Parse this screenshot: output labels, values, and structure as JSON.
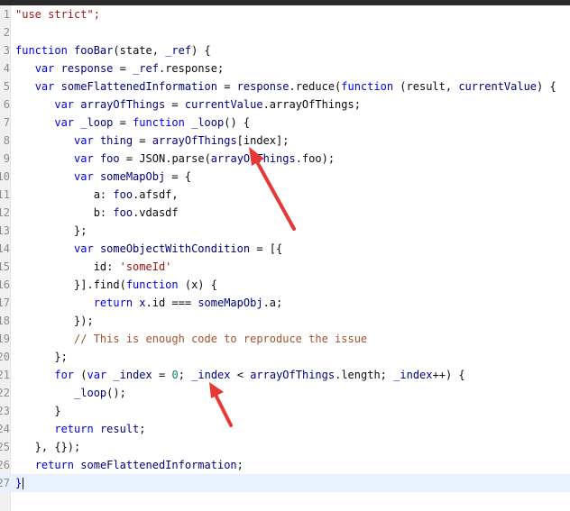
{
  "editor": {
    "lines": [
      {
        "n": "1",
        "tokens": [
          {
            "t": "\"use strict\";",
            "c": "str"
          }
        ]
      },
      {
        "n": "2",
        "tokens": []
      },
      {
        "n": "3",
        "tokens": [
          {
            "t": "function ",
            "c": "kw"
          },
          {
            "t": "fooBar",
            "c": "id"
          },
          {
            "t": "(state, ",
            "c": "prop"
          },
          {
            "t": "_ref",
            "c": "id"
          },
          {
            "t": ") {",
            "c": "prop"
          }
        ]
      },
      {
        "n": "4",
        "tokens": [
          {
            "t": "   ",
            "c": ""
          },
          {
            "t": "var ",
            "c": "kw"
          },
          {
            "t": "response",
            "c": "id"
          },
          {
            "t": " = ",
            "c": "prop"
          },
          {
            "t": "_ref",
            "c": "id"
          },
          {
            "t": ".response;",
            "c": "prop"
          }
        ]
      },
      {
        "n": "5",
        "tokens": [
          {
            "t": "   ",
            "c": ""
          },
          {
            "t": "var ",
            "c": "kw"
          },
          {
            "t": "someFlattenedInformation",
            "c": "id"
          },
          {
            "t": " = ",
            "c": "prop"
          },
          {
            "t": "response",
            "c": "id"
          },
          {
            "t": ".reduce(",
            "c": "prop"
          },
          {
            "t": "function ",
            "c": "kw"
          },
          {
            "t": "(result, ",
            "c": "prop"
          },
          {
            "t": "currentValue",
            "c": "id"
          },
          {
            "t": ") {",
            "c": "prop"
          }
        ]
      },
      {
        "n": "6",
        "tokens": [
          {
            "t": "      ",
            "c": ""
          },
          {
            "t": "var ",
            "c": "kw"
          },
          {
            "t": "arrayOfThings",
            "c": "id"
          },
          {
            "t": " = ",
            "c": "prop"
          },
          {
            "t": "currentValue",
            "c": "id"
          },
          {
            "t": ".arrayOfThings;",
            "c": "prop"
          }
        ]
      },
      {
        "n": "7",
        "tokens": [
          {
            "t": "      ",
            "c": ""
          },
          {
            "t": "var ",
            "c": "kw"
          },
          {
            "t": "_loop",
            "c": "id"
          },
          {
            "t": " = ",
            "c": "prop"
          },
          {
            "t": "function ",
            "c": "kw"
          },
          {
            "t": "_loop",
            "c": "id"
          },
          {
            "t": "() {",
            "c": "prop"
          }
        ]
      },
      {
        "n": "8",
        "tokens": [
          {
            "t": "         ",
            "c": ""
          },
          {
            "t": "var ",
            "c": "kw"
          },
          {
            "t": "thing",
            "c": "id"
          },
          {
            "t": " = ",
            "c": "prop"
          },
          {
            "t": "arrayOfThings",
            "c": "id"
          },
          {
            "t": "[index];",
            "c": "prop"
          }
        ]
      },
      {
        "n": "9",
        "tokens": [
          {
            "t": "         ",
            "c": ""
          },
          {
            "t": "var ",
            "c": "kw"
          },
          {
            "t": "foo",
            "c": "id"
          },
          {
            "t": " = ",
            "c": "prop"
          },
          {
            "t": "JSON",
            "c": "prop"
          },
          {
            "t": ".parse(",
            "c": "prop"
          },
          {
            "t": "arrayOfThings",
            "c": "id"
          },
          {
            "t": ".foo);",
            "c": "prop"
          }
        ]
      },
      {
        "n": "10",
        "tokens": [
          {
            "t": "         ",
            "c": ""
          },
          {
            "t": "var ",
            "c": "kw"
          },
          {
            "t": "someMapObj",
            "c": "id"
          },
          {
            "t": " = {",
            "c": "prop"
          }
        ]
      },
      {
        "n": "11",
        "tokens": [
          {
            "t": "            a: ",
            "c": "prop"
          },
          {
            "t": "foo",
            "c": "id"
          },
          {
            "t": ".afsdf,",
            "c": "prop"
          }
        ]
      },
      {
        "n": "12",
        "tokens": [
          {
            "t": "            b: ",
            "c": "prop"
          },
          {
            "t": "foo",
            "c": "id"
          },
          {
            "t": ".vdasdf",
            "c": "prop"
          }
        ]
      },
      {
        "n": "13",
        "tokens": [
          {
            "t": "         };",
            "c": "prop"
          }
        ]
      },
      {
        "n": "14",
        "tokens": [
          {
            "t": "         ",
            "c": ""
          },
          {
            "t": "var ",
            "c": "kw"
          },
          {
            "t": "someObjectWithCondition",
            "c": "id"
          },
          {
            "t": " = [{",
            "c": "prop"
          }
        ]
      },
      {
        "n": "15",
        "tokens": [
          {
            "t": "            id: ",
            "c": "prop"
          },
          {
            "t": "'someId'",
            "c": "str"
          }
        ]
      },
      {
        "n": "16",
        "tokens": [
          {
            "t": "         }].find(",
            "c": "prop"
          },
          {
            "t": "function ",
            "c": "kw"
          },
          {
            "t": "(x) {",
            "c": "prop"
          }
        ]
      },
      {
        "n": "17",
        "tokens": [
          {
            "t": "            ",
            "c": ""
          },
          {
            "t": "return ",
            "c": "kw"
          },
          {
            "t": "x",
            "c": "id"
          },
          {
            "t": ".id === ",
            "c": "prop"
          },
          {
            "t": "someMapObj",
            "c": "id"
          },
          {
            "t": ".a;",
            "c": "prop"
          }
        ]
      },
      {
        "n": "18",
        "tokens": [
          {
            "t": "         });",
            "c": "prop"
          }
        ]
      },
      {
        "n": "19",
        "tokens": [
          {
            "t": "         ",
            "c": ""
          },
          {
            "t": "// This is enough code to reproduce the issue",
            "c": "com"
          }
        ]
      },
      {
        "n": "20",
        "tokens": [
          {
            "t": "      };",
            "c": "prop"
          }
        ]
      },
      {
        "n": "21",
        "tokens": [
          {
            "t": "      ",
            "c": ""
          },
          {
            "t": "for ",
            "c": "kw"
          },
          {
            "t": "(",
            "c": "prop"
          },
          {
            "t": "var ",
            "c": "kw"
          },
          {
            "t": "_index",
            "c": "id"
          },
          {
            "t": " = ",
            "c": "prop"
          },
          {
            "t": "0",
            "c": "num"
          },
          {
            "t": "; ",
            "c": "prop"
          },
          {
            "t": "_index",
            "c": "id"
          },
          {
            "t": " < ",
            "c": "prop"
          },
          {
            "t": "arrayOfThings",
            "c": "id"
          },
          {
            "t": ".length; ",
            "c": "prop"
          },
          {
            "t": "_index",
            "c": "id"
          },
          {
            "t": "++) {",
            "c": "prop"
          }
        ]
      },
      {
        "n": "22",
        "tokens": [
          {
            "t": "         ",
            "c": ""
          },
          {
            "t": "_loop",
            "c": "id"
          },
          {
            "t": "();",
            "c": "prop"
          }
        ]
      },
      {
        "n": "23",
        "tokens": [
          {
            "t": "      }",
            "c": "prop"
          }
        ]
      },
      {
        "n": "24",
        "tokens": [
          {
            "t": "      ",
            "c": ""
          },
          {
            "t": "return ",
            "c": "kw"
          },
          {
            "t": "result",
            "c": "id"
          },
          {
            "t": ";",
            "c": "prop"
          }
        ]
      },
      {
        "n": "25",
        "tokens": [
          {
            "t": "   }, {});",
            "c": "prop"
          }
        ]
      },
      {
        "n": "26",
        "tokens": [
          {
            "t": "   ",
            "c": ""
          },
          {
            "t": "return ",
            "c": "kw"
          },
          {
            "t": "someFlattenedInformation",
            "c": "id"
          },
          {
            "t": ";",
            "c": "prop"
          }
        ]
      },
      {
        "n": "27",
        "tokens": [
          {
            "t": "}",
            "c": "kw"
          }
        ],
        "current": true
      }
    ]
  },
  "colors": {
    "keyword": "#0000e6",
    "identifier": "#000080",
    "string": "#a31515",
    "number": "#098658",
    "comment": "#a0522d",
    "current_line": "#e8f2fe",
    "annotation_arrow": "#e53935"
  }
}
